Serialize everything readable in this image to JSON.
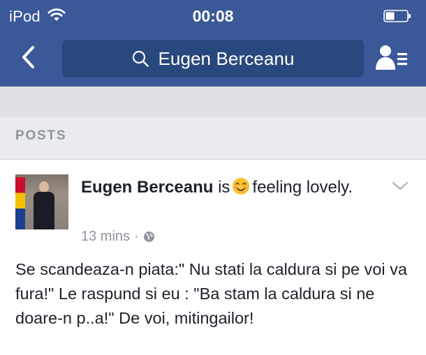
{
  "status_bar": {
    "carrier": "iPod",
    "time": "00:08",
    "icons": [
      "wifi-icon",
      "battery-icon"
    ]
  },
  "nav": {
    "back_icon": "chevron-left-icon",
    "search_icon": "search-icon",
    "search_query": "Eugen Berceanu",
    "friends_icon": "friend-list-icon"
  },
  "section": {
    "label": "POSTS"
  },
  "post": {
    "author": "Eugen Berceanu",
    "verb": "is",
    "feeling_emoji": "smiling-face-icon",
    "feeling_text": "feeling lovely.",
    "time": "13 mins",
    "separator": "·",
    "privacy_icon": "globe-icon",
    "menu_icon": "chevron-down-icon",
    "body": "Se scandeaza-n piata:\" Nu stati la caldura si pe voi va fura!\" Le raspund si eu : \"Ba stam la caldura si ne doare-n p..a!\" De voi, mitingailor!"
  },
  "colors": {
    "brand_blue": "#3b5998",
    "search_bg": "#29487d",
    "background_grey": "#e9ebee",
    "meta_grey": "#90949c",
    "text": "#1d2129"
  }
}
